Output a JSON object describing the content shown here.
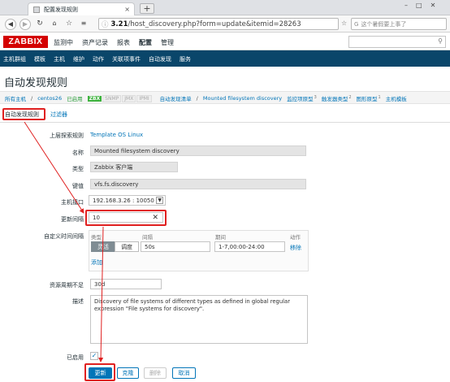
{
  "browser": {
    "tab_title": "配置发现规则",
    "url_host": "3.21",
    "url_prefix": "",
    "url_path": "/host_discovery.php?form=update&itemid=28263",
    "search_placeholder": "这个暑假要上事了",
    "new_tab": "+",
    "win_controls": [
      "–",
      "□",
      "✕"
    ],
    "icons": [
      "back-icon",
      "forward-icon",
      "reload-icon",
      "home-icon",
      "star-icon",
      "info-icon"
    ]
  },
  "zabbix": {
    "logo": "ZABBIX",
    "top_menu": [
      "监测中",
      "资产记录",
      "报表",
      "配置",
      "管理"
    ],
    "top_menu_active": "配置",
    "sub_menu": [
      "主机群组",
      "模板",
      "主机",
      "维护",
      "动作",
      "关联项事件",
      "自动发现",
      "服务"
    ],
    "page_title": "自动发现规则"
  },
  "breadcrumb": {
    "all_hosts": "所有主机",
    "host": "centos26",
    "status": "已启用",
    "tags": [
      "ZBX",
      "SNMP",
      "JMX",
      "IPMI"
    ],
    "rule_list": "自动发现清单",
    "rule_name": "Mounted filesystem discovery",
    "links": [
      {
        "label": "监控项原型",
        "count": "3"
      },
      {
        "label": "触发器类型",
        "count": "2"
      },
      {
        "label": "图形原型",
        "count": "1"
      },
      {
        "label": "主机模板",
        "count": ""
      }
    ]
  },
  "tabs": [
    "自动发现规则",
    "过滤器"
  ],
  "form": {
    "parent_label": "上层探索规则",
    "parent_value": "Template OS Linux",
    "name_label": "名称",
    "name_value": "Mounted filesystem discovery",
    "type_label": "类型",
    "type_value": "Zabbix 客户端",
    "key_label": "键值",
    "key_value": "vfs.fs.discovery",
    "iface_label": "主机接口",
    "iface_value": "192.168.3.26 : 10050",
    "interval_label": "更新间隔",
    "interval_value": "10",
    "custom_label": "自定义时间间隔",
    "custom_headers": [
      "类型",
      "间隔",
      "期间",
      "动作"
    ],
    "custom_type_options": [
      "灵活",
      "调度"
    ],
    "custom_interval": "50s",
    "custom_period": "1-7,00:00-24:00",
    "custom_remove": "移除",
    "custom_add": "添加",
    "keep_label": "资源周期不足",
    "keep_value": "30d",
    "desc_label": "描述",
    "desc_value": "Discovery of file systems of different types as defined in global regular\nexpression \"File systems for discovery\".",
    "enabled_label": "已启用",
    "enabled_check": "✓"
  },
  "buttons": {
    "update": "更新",
    "clone": "克隆",
    "delete": "删除",
    "cancel": "取消"
  },
  "colors": {
    "brand": "#d40000",
    "nav": "#0a466a",
    "link": "#0275b8",
    "annotation": "#e02020"
  }
}
